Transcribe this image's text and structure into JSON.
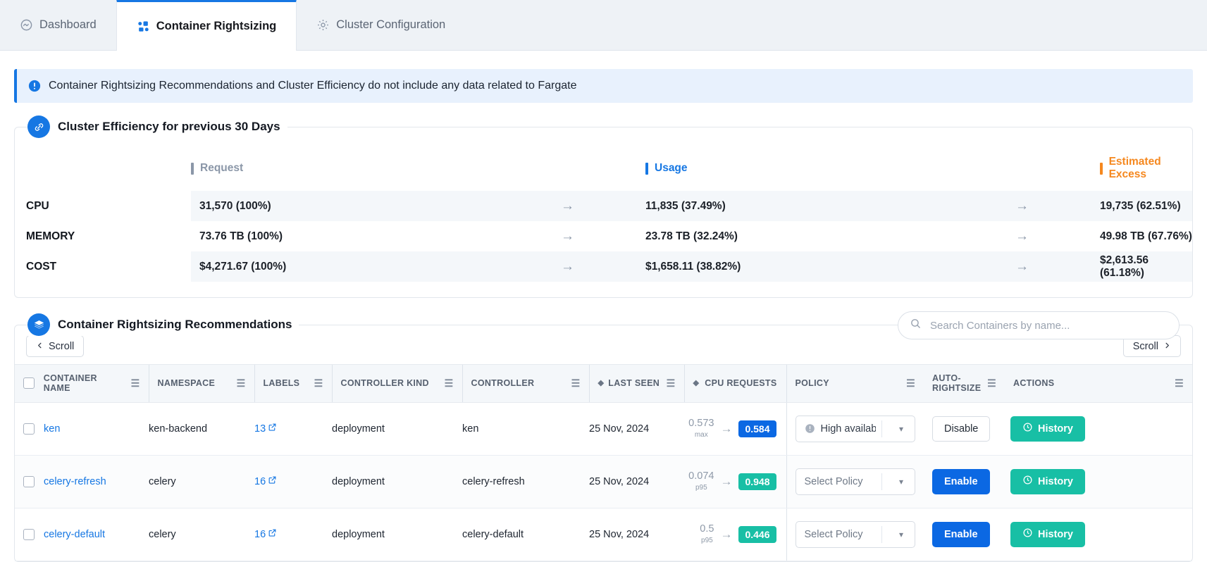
{
  "tabs": [
    {
      "label": "Dashboard",
      "icon": "activity-icon",
      "active": false
    },
    {
      "label": "Container Rightsizing",
      "icon": "rightsizing-icon",
      "active": true
    },
    {
      "label": "Cluster Configuration",
      "icon": "gear-icon",
      "active": false
    }
  ],
  "banner": {
    "icon": "info-icon",
    "text": "Container Rightsizing Recommendations and Cluster Efficiency do not include any data related to Fargate"
  },
  "efficiency": {
    "title": "Cluster Efficiency for previous 30 Days",
    "icon": "efficiency-icon",
    "columns": [
      {
        "label": "Request",
        "color": "#8b97a8"
      },
      {
        "label": "Usage",
        "color": "#1677e3"
      },
      {
        "label": "Estimated Excess",
        "color": "#f5881f"
      }
    ],
    "rows": [
      {
        "label": "CPU",
        "request": "31,570 (100%)",
        "usage": "11,835 (37.49%)",
        "excess": "19,735 (62.51%)"
      },
      {
        "label": "MEMORY",
        "request": "73.76 TB (100%)",
        "usage": "23.78 TB (32.24%)",
        "excess": "49.98 TB (67.76%)"
      },
      {
        "label": "COST",
        "request": "$4,271.67 (100%)",
        "usage": "$1,658.11 (38.82%)",
        "excess": "$2,613.56 (61.18%)"
      }
    ]
  },
  "recommendations": {
    "title": "Container Rightsizing Recommendations",
    "icon": "layers-icon",
    "search": {
      "placeholder": "Search Containers by name...",
      "value": "",
      "icon": "search-icon"
    },
    "scroll_left_label": "Scroll",
    "scroll_right_label": "Scroll",
    "columns": [
      {
        "key": "container_name",
        "label": "CONTAINER NAME",
        "menu": true,
        "sortable": false
      },
      {
        "key": "namespace",
        "label": "NAMESPACE",
        "menu": true,
        "sortable": false
      },
      {
        "key": "labels",
        "label": "LABELS",
        "menu": true,
        "sortable": false
      },
      {
        "key": "controller_kind",
        "label": "CONTROLLER KIND",
        "menu": true,
        "sortable": false
      },
      {
        "key": "controller",
        "label": "CONTROLLER",
        "menu": true,
        "sortable": false
      },
      {
        "key": "last_seen",
        "label": "LAST SEEN",
        "menu": true,
        "sortable": true
      },
      {
        "key": "cpu_requests",
        "label": "CPU REQUESTS",
        "menu": false,
        "sortable": true
      },
      {
        "key": "policy",
        "label": "POLICY",
        "menu": true,
        "sortable": false
      },
      {
        "key": "auto_rightsize",
        "label": "AUTO-RIGHTSIZE",
        "menu": true,
        "sortable": false
      },
      {
        "key": "actions",
        "label": "ACTIONS",
        "menu": true,
        "sortable": false
      }
    ],
    "rows": [
      {
        "selected": false,
        "container_name": "ken",
        "namespace": "ken-backend",
        "labels_count": "13",
        "controller_kind": "deployment",
        "controller": "ken",
        "last_seen": "25 Nov, 2024",
        "cpu_from": "0.573",
        "cpu_stat": "max",
        "cpu_to": "0.584",
        "cpu_to_color": "blue",
        "policy_value": "High availability",
        "policy_has_warning": true,
        "auto_rightsize_label": "Disable",
        "auto_rightsize_style": "ghost",
        "history_label": "History"
      },
      {
        "selected": false,
        "container_name": "celery-refresh",
        "namespace": "celery",
        "labels_count": "16",
        "controller_kind": "deployment",
        "controller": "celery-refresh",
        "last_seen": "25 Nov, 2024",
        "cpu_from": "0.074",
        "cpu_stat": "p95",
        "cpu_to": "0.948",
        "cpu_to_color": "teal",
        "policy_value": "Select Policy",
        "policy_has_warning": false,
        "auto_rightsize_label": "Enable",
        "auto_rightsize_style": "blue",
        "history_label": "History"
      },
      {
        "selected": false,
        "container_name": "celery-default",
        "namespace": "celery",
        "labels_count": "16",
        "controller_kind": "deployment",
        "controller": "celery-default",
        "last_seen": "25 Nov, 2024",
        "cpu_from": "0.5",
        "cpu_stat": "p95",
        "cpu_to": "0.446",
        "cpu_to_color": "teal",
        "policy_value": "Select Policy",
        "policy_has_warning": false,
        "auto_rightsize_label": "Enable",
        "auto_rightsize_style": "blue",
        "history_label": "History"
      }
    ]
  },
  "colors": {
    "accent_blue": "#1677e3",
    "teal": "#18bfa5",
    "orange": "#f5881f",
    "muted": "#8b97a8"
  }
}
